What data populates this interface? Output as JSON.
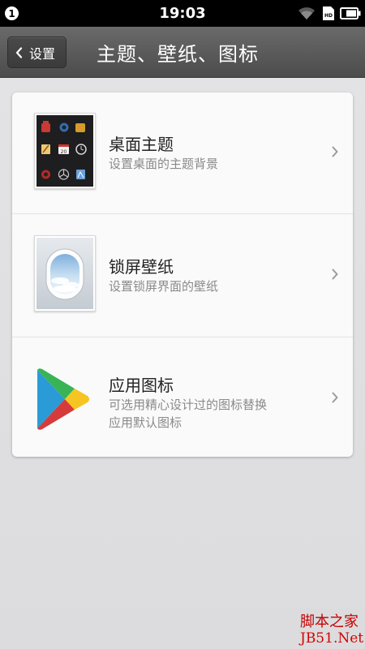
{
  "status_bar": {
    "notification_count": "1",
    "time": "19:03",
    "sim_label": "HD"
  },
  "header": {
    "back_label": "设置",
    "title": "主题、壁纸、图标"
  },
  "items": [
    {
      "title": "桌面主题",
      "description": "设置桌面的主题背景",
      "calendar_day": "20"
    },
    {
      "title": "锁屏壁纸",
      "description": "设置锁屏界面的壁纸"
    },
    {
      "title": "应用图标",
      "description_line1": "可选用精心设计过的图标替换",
      "description_line2": "应用默认图标"
    }
  ],
  "watermark": {
    "line1": "脚本之家",
    "line2": "JB51.Net"
  }
}
